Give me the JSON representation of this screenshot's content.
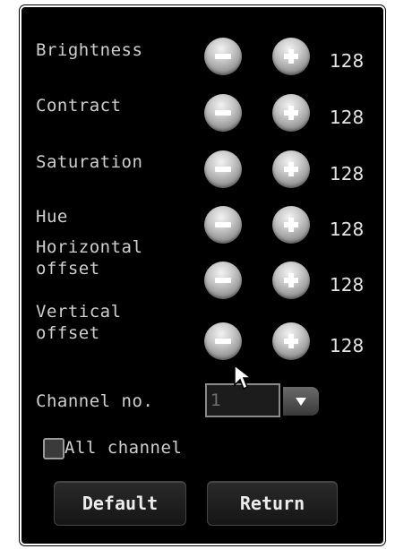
{
  "rows": [
    {
      "label": "Brightness",
      "value": "128"
    },
    {
      "label": "Contract",
      "value": "128"
    },
    {
      "label": "Saturation",
      "value": "128"
    },
    {
      "label": "Hue",
      "value": "128"
    },
    {
      "label": "Horizontal\noffset",
      "value": "128"
    },
    {
      "label": "Vertical\noffset",
      "value": "128"
    }
  ],
  "channel": {
    "label": "Channel no.",
    "value": "1"
  },
  "all_channel": {
    "label": "All channel",
    "checked": false
  },
  "buttons": {
    "default_label": "Default",
    "return_label": "Return"
  },
  "icons": {
    "decrease": "minus-icon",
    "increase": "plus-icon",
    "dropdown": "triangle-down-icon",
    "pointer": "mouse-cursor-icon"
  },
  "colors": {
    "background": "#000000",
    "text": "#cfcfcf",
    "button_face": "#c9c9c9"
  }
}
